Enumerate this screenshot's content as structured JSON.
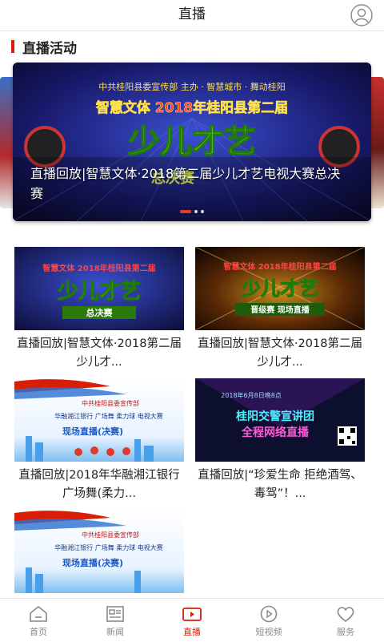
{
  "header": {
    "title": "直播"
  },
  "section": {
    "title": "直播活动"
  },
  "carousel": {
    "caption": "直播回放|智慧文体·2018第二届少儿才艺电视大赛总决赛",
    "banner": {
      "top_line": "中共桂阳县委宣传部 主办 · 智慧城市 · 舞动桂阳",
      "headline": "智慧文体 2018年桂阳县第二届",
      "logo_text": "少儿才艺",
      "sub_text": "总决赛"
    },
    "dots": 3,
    "active_dot": 0
  },
  "cards": [
    {
      "title": "直播回放|智慧文体·2018第二届少儿才...",
      "thumb": {
        "headline": "智慧文体 2018年桂阳县第二届",
        "logo_text": "少儿才艺",
        "badge": "总决赛"
      }
    },
    {
      "title": "直播回放|智慧文体·2018第二届少儿才...",
      "thumb": {
        "headline": "智慧文体 2018年桂阳县第二届",
        "logo_text": "少儿才艺",
        "badge": "晋级赛 现场直播"
      }
    },
    {
      "title": "直播回放|2018年华融湘江银行广场舞(柔力...",
      "thumb": {
        "line1": "中共桂阳县委宣传部",
        "line2": "华融湘江银行 广场舞 柔力球 电视大赛",
        "badge": "现场直播(决赛)"
      }
    },
    {
      "title": "直播回放|“珍爱生命 拒绝酒驾、毒驾”！...",
      "thumb": {
        "date": "2018年6月8日晚8点",
        "headline": "桂阳交警宣讲团",
        "sub": "全程网络直播"
      }
    },
    {
      "title": "",
      "thumb": {
        "line1": "中共桂阳县委宣传部",
        "line2": "华融湘江银行 广场舞 柔力球 电视大赛",
        "badge": "现场直播(决赛)"
      }
    }
  ],
  "tabbar": {
    "items": [
      {
        "label": "首页",
        "icon": "home-icon"
      },
      {
        "label": "新闻",
        "icon": "news-icon"
      },
      {
        "label": "直播",
        "icon": "live-icon"
      },
      {
        "label": "短视频",
        "icon": "video-icon"
      },
      {
        "label": "服务",
        "icon": "heart-icon"
      }
    ],
    "active": 2,
    "active_color": "#d81e06",
    "inactive_color": "#888888"
  },
  "colors": {
    "accent": "#d81e06"
  }
}
